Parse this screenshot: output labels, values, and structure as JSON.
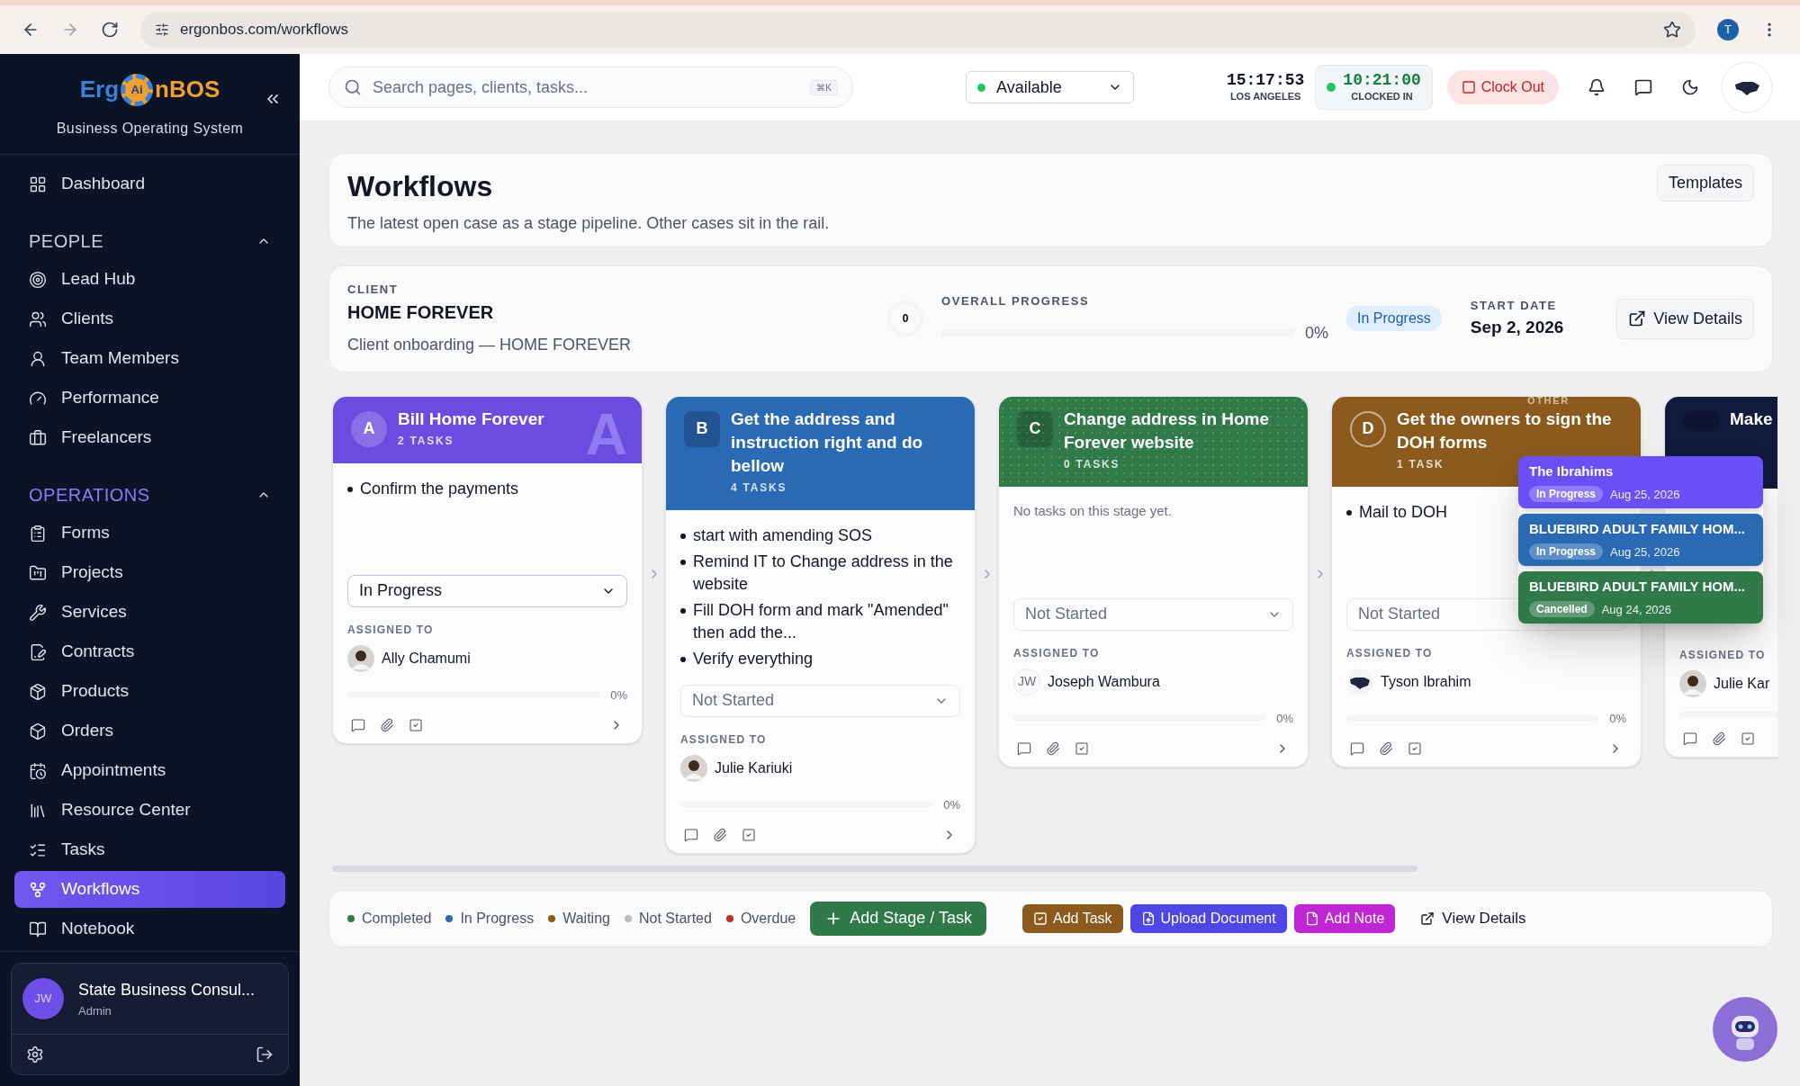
{
  "browser": {
    "url": "ergonbos.com/workflows",
    "profile": "T"
  },
  "sidebar": {
    "logo": {
      "left": "Erg",
      "badge": "Ai",
      "right": "nBOS"
    },
    "subtitle": "Business Operating System",
    "items": [
      {
        "label": "Dashboard",
        "selected": false
      }
    ],
    "sections": [
      {
        "title": "PEOPLE",
        "expanded": true,
        "active": false,
        "items": [
          {
            "label": "Lead Hub",
            "selected": false
          },
          {
            "label": "Clients",
            "selected": false
          },
          {
            "label": "Team Members",
            "selected": false
          },
          {
            "label": "Performance",
            "selected": false
          },
          {
            "label": "Freelancers",
            "selected": false
          }
        ]
      },
      {
        "title": "OPERATIONS",
        "expanded": true,
        "active": true,
        "items": [
          {
            "label": "Forms",
            "selected": false
          },
          {
            "label": "Projects",
            "selected": false
          },
          {
            "label": "Services",
            "selected": false
          },
          {
            "label": "Contracts",
            "selected": false
          },
          {
            "label": "Products",
            "selected": false
          },
          {
            "label": "Orders",
            "selected": false
          },
          {
            "label": "Appointments",
            "selected": false
          },
          {
            "label": "Resource Center",
            "selected": false
          },
          {
            "label": "Tasks",
            "selected": false
          },
          {
            "label": "Workflows",
            "selected": true
          },
          {
            "label": "Notebook",
            "selected": false
          }
        ]
      }
    ],
    "user": {
      "initials": "JW",
      "name": "State Business Consul...",
      "role": "Admin"
    }
  },
  "header": {
    "search": {
      "placeholder": "Search pages, clients, tasks...",
      "shortcut": "⌘K"
    },
    "availability": {
      "value": "Available",
      "color": "#22c55e"
    },
    "time": "15:17:53",
    "zone": "LOS ANGELES",
    "timer": "10:21:00",
    "timer_label": "CLOCKED IN",
    "clock_out": "Clock Out"
  },
  "page": {
    "title": "Workflows",
    "subtitle": "The latest open case as a stage pipeline. Other cases sit in the rail.",
    "templates_button": "Templates"
  },
  "client": {
    "label": "CLIENT",
    "name": "HOME FOREVER",
    "description": "Client onboarding — HOME FOREVER",
    "ring": "0",
    "progress_label": "OVERALL PROGRESS",
    "level": 0,
    "percent": "0%",
    "status": "In Progress",
    "start_label": "START DATE",
    "start_date": "Sep 2, 2026",
    "view_button": "View Details"
  },
  "stages": [
    {
      "badge": {
        "kind": "circle",
        "letter": "A"
      },
      "backdrop_letter": "A",
      "pattern": false,
      "color": "#6a4de0",
      "title": "Bill Home Forever",
      "count": "2 TASKS",
      "tasks": [
        "Confirm the payments"
      ],
      "status": {
        "value": "In Progress",
        "active": true
      },
      "assigned_label": "ASSIGNED TO",
      "assignee": {
        "name": "Ally Chamumi",
        "avatar": {
          "kind": "photo"
        }
      },
      "level": 0,
      "percent": "0%"
    },
    {
      "badge": {
        "kind": "square",
        "letter": "B"
      },
      "pattern": false,
      "color": "#2a6ab4",
      "title": "Get the address and instruction right and do bellow",
      "count": "4 TASKS",
      "tasks": [
        "start with amending SOS",
        "Remind IT to Change address in the website",
        "Fill DOH form and mark \"Amended\" then add the...",
        "Verify everything"
      ],
      "status": {
        "value": "Not Started",
        "active": false
      },
      "assigned_label": "ASSIGNED TO",
      "assignee": {
        "name": "Julie Kariuki",
        "avatar": {
          "kind": "photo"
        }
      },
      "level": 0,
      "percent": "0%"
    },
    {
      "badge": {
        "kind": "square",
        "letter": "C"
      },
      "pattern": true,
      "color": "#2f7a48",
      "title": "Change address in Home Forever website",
      "count": "0 TASKS",
      "empty_text": "No tasks on this stage yet.",
      "status": {
        "value": "Not Started",
        "active": false
      },
      "assigned_label": "ASSIGNED TO",
      "assignee": {
        "name": "Joseph Wambura",
        "avatar": {
          "kind": "initials",
          "text": "JW"
        }
      },
      "level": 0,
      "percent": "0%"
    },
    {
      "badge": {
        "kind": "ring",
        "letter": "D"
      },
      "pattern": false,
      "color": "#8b5a1c",
      "title": "Get the owners to sign the DOH forms",
      "count": "1 TASK",
      "tasks": [
        "Mail to DOH"
      ],
      "status": {
        "value": "Not Started",
        "active": false
      },
      "assigned_label": "ASSIGNED TO",
      "assignee": {
        "name": "Tyson Ibrahim",
        "avatar": {
          "kind": "logo"
        }
      },
      "level": 0,
      "percent": "0%"
    },
    {
      "badge": {
        "kind": "square"
      },
      "pattern": false,
      "color": "#101a3c",
      "title": "Make",
      "assigned_label": "ASSIGNED TO",
      "assignee": {
        "name": "Julie Kar",
        "avatar": {
          "kind": "photo"
        }
      },
      "level": 0
    }
  ],
  "rail": {
    "label": "OTHER",
    "cases": [
      {
        "name": "The Ibrahims",
        "status": "In Progress",
        "date": "Aug 25, 2026",
        "color": "#6b4ef5"
      },
      {
        "name": "BLUEBIRD ADULT FAMILY HOM...",
        "status": "In Progress",
        "date": "Aug 25, 2026",
        "color": "#2a6ab4"
      },
      {
        "name": "BLUEBIRD ADULT FAMILY HOM...",
        "status": "Cancelled",
        "date": "Aug 24, 2026",
        "color": "#2f7a48"
      }
    ]
  },
  "footer": {
    "legend": [
      {
        "label": "Completed",
        "color": "#2f7a48"
      },
      {
        "label": "In Progress",
        "color": "#2a6ab4"
      },
      {
        "label": "Waiting",
        "color": "#8b5a1c"
      },
      {
        "label": "Not Started",
        "color": "#bdbdbd"
      },
      {
        "label": "Overdue",
        "color": "#c62828"
      }
    ],
    "add_stage": "Add Stage / Task",
    "actions": [
      {
        "kind": "task",
        "label": "Add Task",
        "color": "#8b5a1c"
      },
      {
        "kind": "upload",
        "label": "Upload Document",
        "color": "#4f46e5"
      },
      {
        "kind": "note",
        "label": "Add Note",
        "color": "#c026d3"
      }
    ],
    "view_details": "View Details"
  }
}
